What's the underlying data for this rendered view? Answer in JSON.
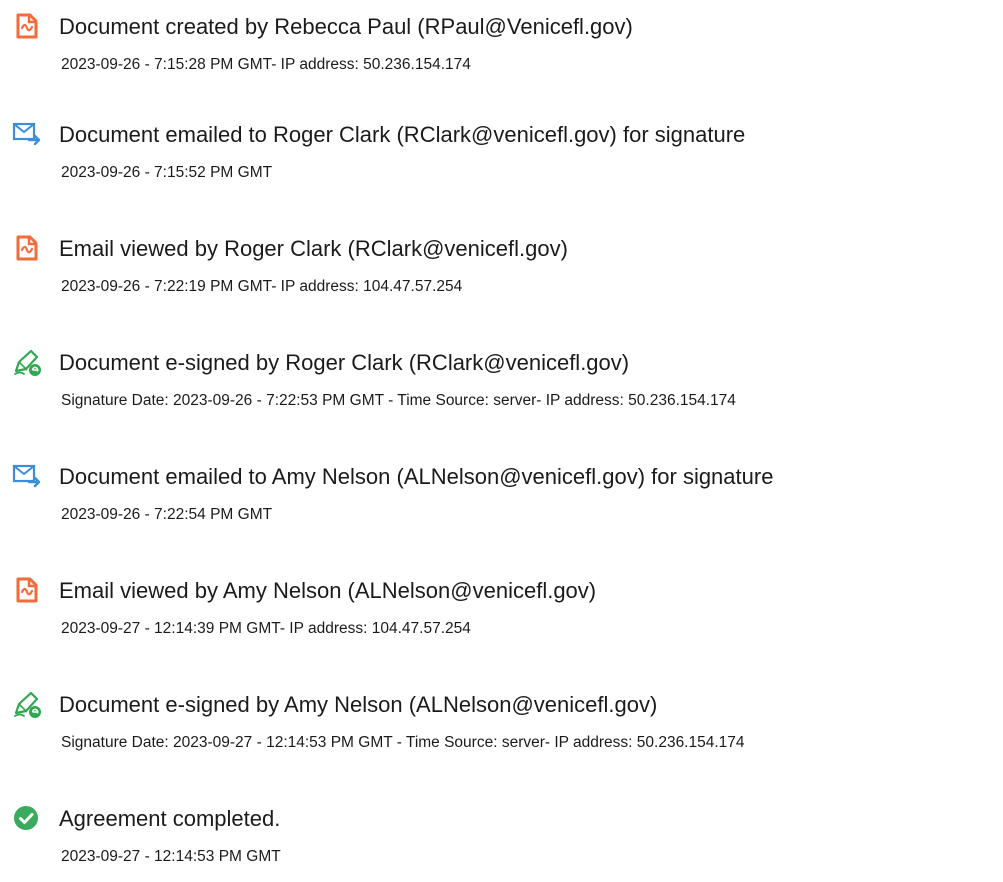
{
  "events": [
    {
      "icon": "document-icon",
      "title": "Document created by Rebecca Paul (RPaul@Venicefl.gov)",
      "detail": "2023-09-26 - 7:15:28 PM GMT- IP address: 50.236.154.174"
    },
    {
      "icon": "email-send-icon",
      "title": "Document emailed to Roger Clark (RClark@venicefl.gov) for signature",
      "detail": "2023-09-26 - 7:15:52 PM GMT"
    },
    {
      "icon": "document-icon",
      "title": "Email viewed by Roger Clark (RClark@venicefl.gov)",
      "detail": "2023-09-26 - 7:22:19 PM GMT- IP address: 104.47.57.254"
    },
    {
      "icon": "pen-sign-icon",
      "title": "Document e-signed by Roger Clark (RClark@venicefl.gov)",
      "detail": "Signature Date: 2023-09-26 - 7:22:53 PM GMT - Time Source: server- IP address: 50.236.154.174"
    },
    {
      "icon": "email-send-icon",
      "title": "Document emailed to Amy Nelson (ALNelson@venicefl.gov) for signature",
      "detail": "2023-09-26 - 7:22:54 PM GMT"
    },
    {
      "icon": "document-icon",
      "title": "Email viewed by Amy Nelson (ALNelson@venicefl.gov)",
      "detail": "2023-09-27 - 12:14:39 PM GMT- IP address: 104.47.57.254"
    },
    {
      "icon": "pen-sign-icon",
      "title": "Document e-signed by Amy Nelson (ALNelson@venicefl.gov)",
      "detail": "Signature Date: 2023-09-27 - 12:14:53 PM GMT - Time Source: server- IP address: 50.236.154.174"
    },
    {
      "icon": "checkmark-circle-icon",
      "title": "Agreement completed.",
      "detail": "2023-09-27 - 12:14:53 PM GMT"
    }
  ],
  "colors": {
    "document_icon": "#f26b3a",
    "email_icon": "#3a8fd6",
    "sign_icon": "#2fa84f",
    "check_icon": "#3aaa5c"
  }
}
